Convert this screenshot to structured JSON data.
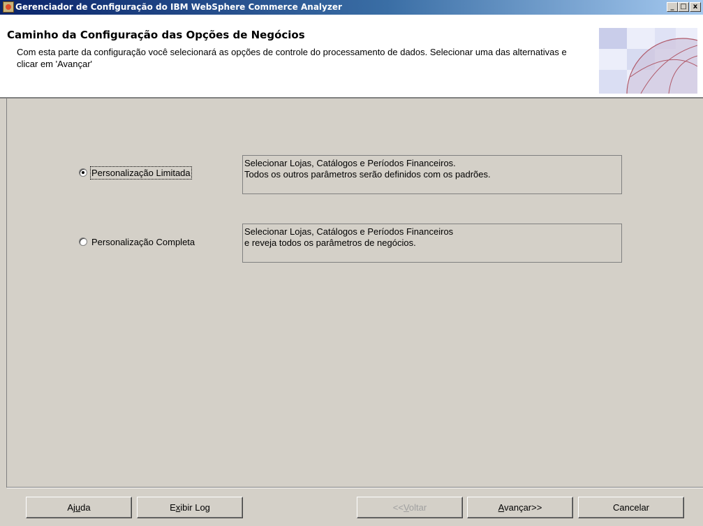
{
  "window": {
    "title": "Gerenciador de Configuração do IBM WebSphere Commerce Analyzer",
    "controls": {
      "minimize": "_",
      "maximize": "□",
      "close": "x"
    }
  },
  "header": {
    "title": "Caminho da Configuração das Opções de Negócios",
    "description": "Com esta parte da configuração você selecionará as opções de controle do processamento de dados. Selecionar uma das alternativas e clicar em 'Avançar'"
  },
  "options": [
    {
      "label": "Personalização Limitada",
      "selected": true,
      "description_line1": "Selecionar Lojas, Catálogos e Períodos Financeiros.",
      "description_line2": "Todos os outros parâmetros serão definidos com os padrões."
    },
    {
      "label": "Personalização Completa",
      "selected": false,
      "description_line1": "Selecionar Lojas, Catálogos e Períodos Financeiros",
      "description_line2": "e reveja todos os parâmetros de negócios."
    }
  ],
  "buttons": {
    "help": {
      "pre": "Aj",
      "mnemonic": "u",
      "post": "da"
    },
    "log": {
      "pre": "E",
      "mnemonic": "x",
      "post": "ibir Log"
    },
    "back": {
      "pre": "<<",
      "mnemonic": "V",
      "post": "oltar",
      "enabled": false
    },
    "next": {
      "pre": "",
      "mnemonic": "A",
      "post": "vançar>>"
    },
    "cancel": {
      "label": "Cancelar"
    }
  },
  "colors": {
    "title_bar_start": "#0a246a",
    "title_bar_end": "#a6caf0",
    "panel": "#d4d0c8"
  }
}
